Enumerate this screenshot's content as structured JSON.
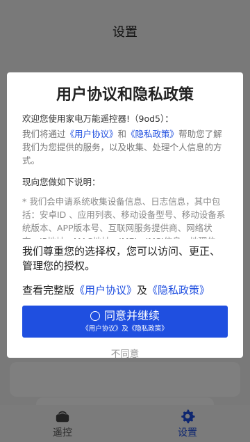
{
  "app": {
    "title": "设置",
    "tabs": [
      {
        "label": "遥控",
        "icon": "remote-icon",
        "active": false
      },
      {
        "label": "设置",
        "icon": "gear-icon",
        "active": true
      }
    ]
  },
  "dialog": {
    "title": "用户协议和隐私政策",
    "welcome": "欢迎您使用家电万能遥控器!（9od5）：",
    "intro": {
      "prefix": "我们将通过",
      "user_agreement": "《用户协议》",
      "and": "和",
      "privacy_policy": "《隐私政策》",
      "suffix": "帮助您了解我们为您提供的服务，以及收集、处理个人信息的方式。"
    },
    "subtitle": "现向您做如下说明：",
    "scroll_text": "* 我们会申请系统收集设备信息、日志信息，其中包括：安卓ID 、应用列表、移动设备型号、移动设备系统版本、APP版本号、互联网服务提供商、网络状态、IP地址、MAC地址、IMEI、IMSI信息、地理位置，用于统",
    "respect": "我们尊重您的选择权，您可以访问、更正、管理您的授权。",
    "full": {
      "prefix": "查看完整版",
      "user_agreement": "《用户协议》",
      "and": "及",
      "privacy_policy": "《隐私政策》"
    },
    "agree_button": "同意并继续",
    "agree_sub": "《用户协议》及《隐私政策》",
    "disagree_button": "不同意"
  },
  "colors": {
    "accent": "#1f4fe0",
    "overlay": "rgba(0,0,0,0.5)"
  }
}
